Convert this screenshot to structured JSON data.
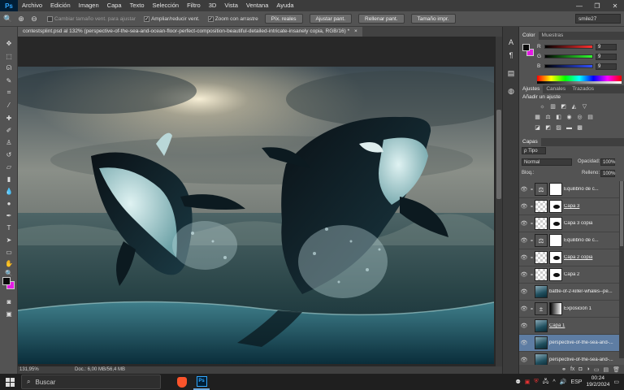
{
  "app": {
    "logo": "Ps"
  },
  "menu": [
    "Archivo",
    "Edición",
    "Imagen",
    "Capa",
    "Texto",
    "Selección",
    "Filtro",
    "3D",
    "Vista",
    "Ventana",
    "Ayuda"
  ],
  "window_controls": [
    "—",
    "❐",
    "✕"
  ],
  "options": {
    "resize_windows": "Cambiar tamaño vent. para ajustar",
    "zoom_all": "Ampliar/reducir vent.",
    "scrubby_zoom": "Zoom con arrastre",
    "buttons": [
      "Píx. reales",
      "Ajustar pant.",
      "Rellenar pant.",
      "Tamaño impr."
    ],
    "workspace": "smile27"
  },
  "document": {
    "tab_title": "contestsplint.psd al 132% (perspective-of-the-sea-and-ocean-floor-perfect-composition-beautiful-detailed-intricate-insanely copia, RGB/16) *",
    "close_symbol": "×",
    "zoom": "131,95%",
    "doc_info": "Doc.: 6,00 MB/56,4 MB"
  },
  "color_panel": {
    "tabs": [
      "Color",
      "Muestras"
    ],
    "channels": [
      {
        "label": "R",
        "value": "9",
        "color": "#ff3030"
      },
      {
        "label": "G",
        "value": "9",
        "color": "#30ff30"
      },
      {
        "label": "B",
        "value": "9",
        "color": "#3050ff"
      }
    ]
  },
  "adjustments_panel": {
    "tabs": [
      "Ajustes",
      "Canales",
      "Trazados"
    ],
    "title": "Añadir un ajuste",
    "icons_row1": [
      "☼",
      "▥",
      "◩",
      "◭",
      "▽"
    ],
    "icons_row2": [
      "▦",
      "⚖",
      "◧",
      "◉",
      "◎",
      "▤"
    ],
    "icons_row3": [
      "◪",
      "◩",
      "▨",
      "▬",
      "▩"
    ]
  },
  "layers_panel": {
    "tab": "Capas",
    "filter_kind": "ρ Tipo",
    "blend_mode": "Normal",
    "opacity_label": "Opacidad:",
    "opacity_value": "100%",
    "lock_label": "Bloq.:",
    "fill_label": "Relleno:",
    "fill_value": "100%",
    "layers": [
      {
        "name": "Equilibrio de c...",
        "thumb": "adj",
        "thumb_icon": "⚖",
        "mask": "white",
        "underline": false,
        "selected": false
      },
      {
        "name": "Capa 3",
        "thumb": "checker",
        "mask": "mask",
        "underline": true,
        "selected": false
      },
      {
        "name": "Capa 3 copia",
        "thumb": "checker",
        "mask": "mask",
        "underline": false,
        "selected": false
      },
      {
        "name": "Equilibrio de c...",
        "thumb": "adj",
        "thumb_icon": "⚖",
        "mask": "white",
        "underline": false,
        "selected": false
      },
      {
        "name": "Capa 2 copia",
        "thumb": "checker",
        "mask": "mask",
        "underline": true,
        "selected": false
      },
      {
        "name": "Capa 2",
        "thumb": "checker",
        "mask": "mask",
        "underline": false,
        "selected": false
      },
      {
        "name": "battle-of-2-killer-whales--pe...",
        "thumb": "photo",
        "mask": "",
        "underline": false,
        "selected": false
      },
      {
        "name": "Exposición 1",
        "thumb": "adj",
        "thumb_icon": "±",
        "mask": "grad",
        "underline": false,
        "selected": false
      },
      {
        "name": "Capa 1",
        "thumb": "photo",
        "mask": "",
        "underline": true,
        "selected": false
      },
      {
        "name": "perspective-of-the-sea-and-...",
        "thumb": "photo",
        "mask": "",
        "underline": false,
        "selected": true
      },
      {
        "name": "perspective-of-the-sea-and-...",
        "thumb": "photo",
        "mask": "",
        "underline": false,
        "selected": false
      }
    ],
    "footer_icons": [
      "⚭",
      "fx",
      "◘",
      "◑",
      "▭",
      "▤",
      "🗑"
    ]
  },
  "taskbar": {
    "search_placeholder": "Buscar",
    "lang": "ESP",
    "time": "00:24",
    "date": "19/2/2024"
  }
}
